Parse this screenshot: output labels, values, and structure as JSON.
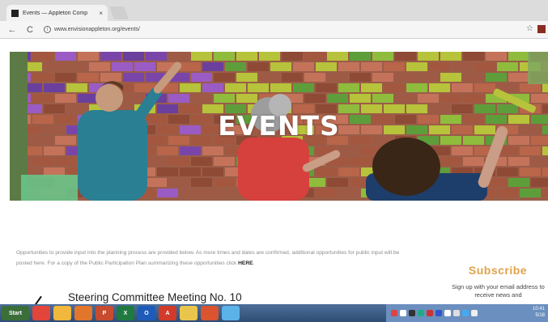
{
  "browser": {
    "tab_title": "Events — Appleton Comp",
    "tab_close": "×",
    "url": "www.envisionappleton.org/events/",
    "back_glyph": "←",
    "reload_glyph": "C",
    "info_glyph": "i",
    "star_glyph": "☆",
    "icons": [
      "favicon",
      "back-arrow-icon",
      "reload-icon",
      "info-icon",
      "bookmark-star-icon",
      "extension-icon"
    ]
  },
  "hero": {
    "title": "EVENTS"
  },
  "content": {
    "intro_text": "Opportunities to provide input into the planning process are provided below. As more times and dates are confirmed, additional opportunities for public input will be posted here. For a copy of the Public Participation Plan summarizing these opportunities click",
    "intro_link": "HERE",
    "intro_end": ".",
    "meeting_title": "Steering Committee Meeting No. 10"
  },
  "subscribe": {
    "heading": "Subscribe",
    "text": "Sign up with your email address to receive news and"
  },
  "taskbar": {
    "start_label": "Start",
    "apps": [
      {
        "name": "chrome",
        "label": "",
        "color": "#e2463a"
      },
      {
        "name": "explorer",
        "label": "",
        "color": "#f0b83c"
      },
      {
        "name": "firefox",
        "label": "",
        "color": "#e2762b"
      },
      {
        "name": "powerpoint",
        "label": "P",
        "color": "#c84b2f"
      },
      {
        "name": "excel",
        "label": "X",
        "color": "#1f7a3f"
      },
      {
        "name": "outlook",
        "label": "O",
        "color": "#1e5bb8"
      },
      {
        "name": "acrobat",
        "label": "A",
        "color": "#d23a2a"
      },
      {
        "name": "paint",
        "label": "",
        "color": "#e9c64b"
      },
      {
        "name": "media",
        "label": "",
        "color": "#d9542f"
      },
      {
        "name": "network",
        "label": "",
        "color": "#5bb2e8"
      }
    ],
    "clock_time": "10:41",
    "clock_date": "5/18"
  }
}
